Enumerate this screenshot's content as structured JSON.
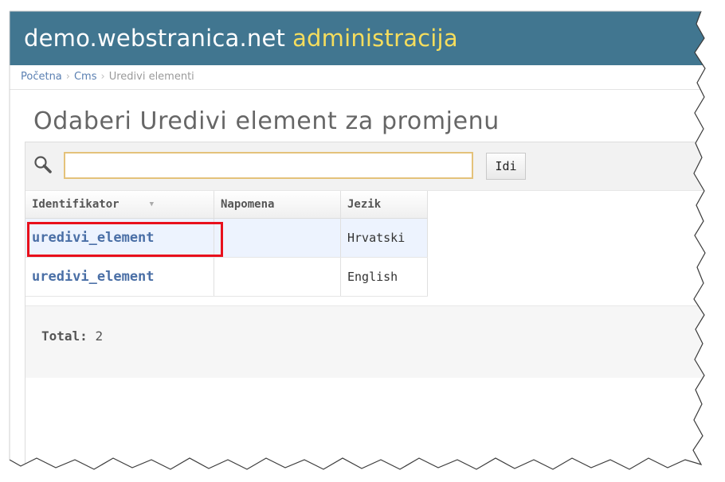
{
  "header": {
    "site_name": "demo.webstranica.net",
    "admin_label": "administracija",
    "bg_color": "#417690",
    "admin_color": "#f5dd5d"
  },
  "breadcrumbs": {
    "items": [
      "Početna",
      "Cms",
      "Uredivi elementi"
    ],
    "separator": "›"
  },
  "page_title": "Odaberi Uredivi element za promjenu",
  "search": {
    "value": "",
    "placeholder": "",
    "button_label": "Idi",
    "icon": "search-icon"
  },
  "table": {
    "columns": [
      "Identifikator",
      "Napomena",
      "Jezik"
    ],
    "sort_icon": "sort-arrow-icon",
    "rows": [
      {
        "identifikator": "uredivi_element",
        "napomena": "",
        "jezik": "Hrvatski",
        "highlighted": true
      },
      {
        "identifikator": "uredivi_element",
        "napomena": "",
        "jezik": "English",
        "highlighted": false
      }
    ]
  },
  "footer": {
    "total_label": "Total:",
    "total_count": "2"
  }
}
